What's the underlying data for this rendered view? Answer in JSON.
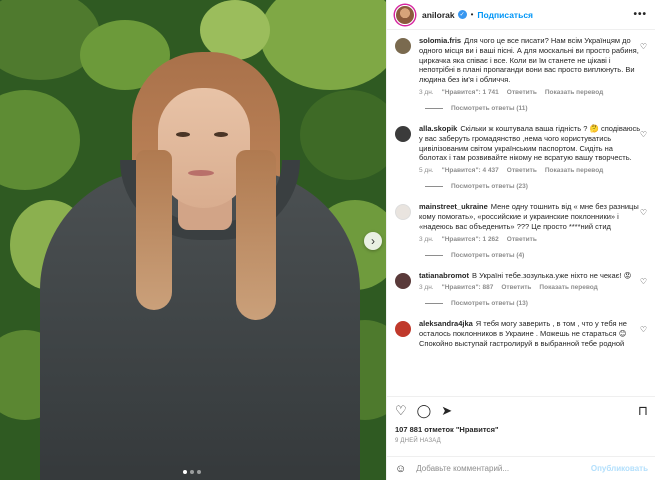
{
  "post": {
    "username": "anilorak",
    "follow_label": "Подписаться",
    "separator": "•",
    "more_label": "•••"
  },
  "comments": [
    {
      "username": "solomia.fris",
      "text": "Для чого це все писати? Нам всім Українцям до одного місця ви і ваші пісні. А для москальні ви просто рабиня, циркачка яка співає і все. Коли ви їм станете не цікаві і непотрібні в плані пропаганди вони вас просто виплюнуть. Ви людина без ім'я і обличчя.",
      "age": "3 дн.",
      "likes": "\"Нравится\": 1 741",
      "reply": "Ответить",
      "translate": "Показать перевод",
      "replies": "Посмотреть ответы (11)",
      "avatar_color": "#7a6a4f"
    },
    {
      "username": "alla.skopik",
      "text": "Скільки ж коштувала ваша гідність ? 🤔 сподіваюсь у вас заберуть громадянство ,нема чого користуватись цивілізованим світом українським паспортом. Сидіть на болотах і там розвивайте нікому не всратую вашу творчесть.",
      "age": "5 дн.",
      "likes": "\"Нравится\": 4 437",
      "reply": "Ответить",
      "translate": "Показать перевод",
      "replies": "Посмотреть ответы (23)",
      "avatar_color": "#3b3b3b"
    },
    {
      "username": "mainstreet_ukraine",
      "text": "Мене одну тошнить від « мне без разницы кому помогать», «российские и украинские поклонники» і «надеюсь вас объеденить» ??? Це просто ****ний стид",
      "age": "3 дн.",
      "likes": "\"Нравится\": 1 262",
      "reply": "Ответить",
      "translate": "",
      "replies": "Посмотреть ответы (4)",
      "avatar_color": "#e9e4df"
    },
    {
      "username": "tatianabromot",
      "text": "В Україні тебе.зозулька.уже ніхто не чекає! 😡",
      "age": "3 дн.",
      "likes": "\"Нравится\": 887",
      "reply": "Ответить",
      "translate": "Показать перевод",
      "replies": "Посмотреть ответы (13)",
      "avatar_color": "#5a3a3a"
    },
    {
      "username": "aleksandra4jka",
      "text": "Я тебя могу заверить , в том , что у тебя не осталось поклонников в Украине . Можешь не стараться 😊 Спокойно выступай гастролируй в выбранной тебе родной",
      "age": "",
      "likes": "",
      "reply": "",
      "translate": "",
      "replies": "",
      "avatar_color": "#c0392b"
    }
  ],
  "engagement": {
    "likes_text": "107 881 отметок \"Нравится\"",
    "time_ago": "9 ДНЕЙ НАЗАД"
  },
  "add_comment": {
    "placeholder": "Добавьте комментарий...",
    "publish_label": "Опубликовать"
  },
  "icons": {
    "heart": "heart-icon",
    "comment": "comment-icon",
    "share": "share-icon",
    "bookmark": "bookmark-icon",
    "emoji": "emoji-icon",
    "next": "chevron-right-icon",
    "verified": "verified-badge-icon"
  },
  "colors": {
    "accent": "#0095f6",
    "muted": "#8e8e8e",
    "text": "#262626"
  },
  "carousel": {
    "slides": 3,
    "active": 1
  }
}
